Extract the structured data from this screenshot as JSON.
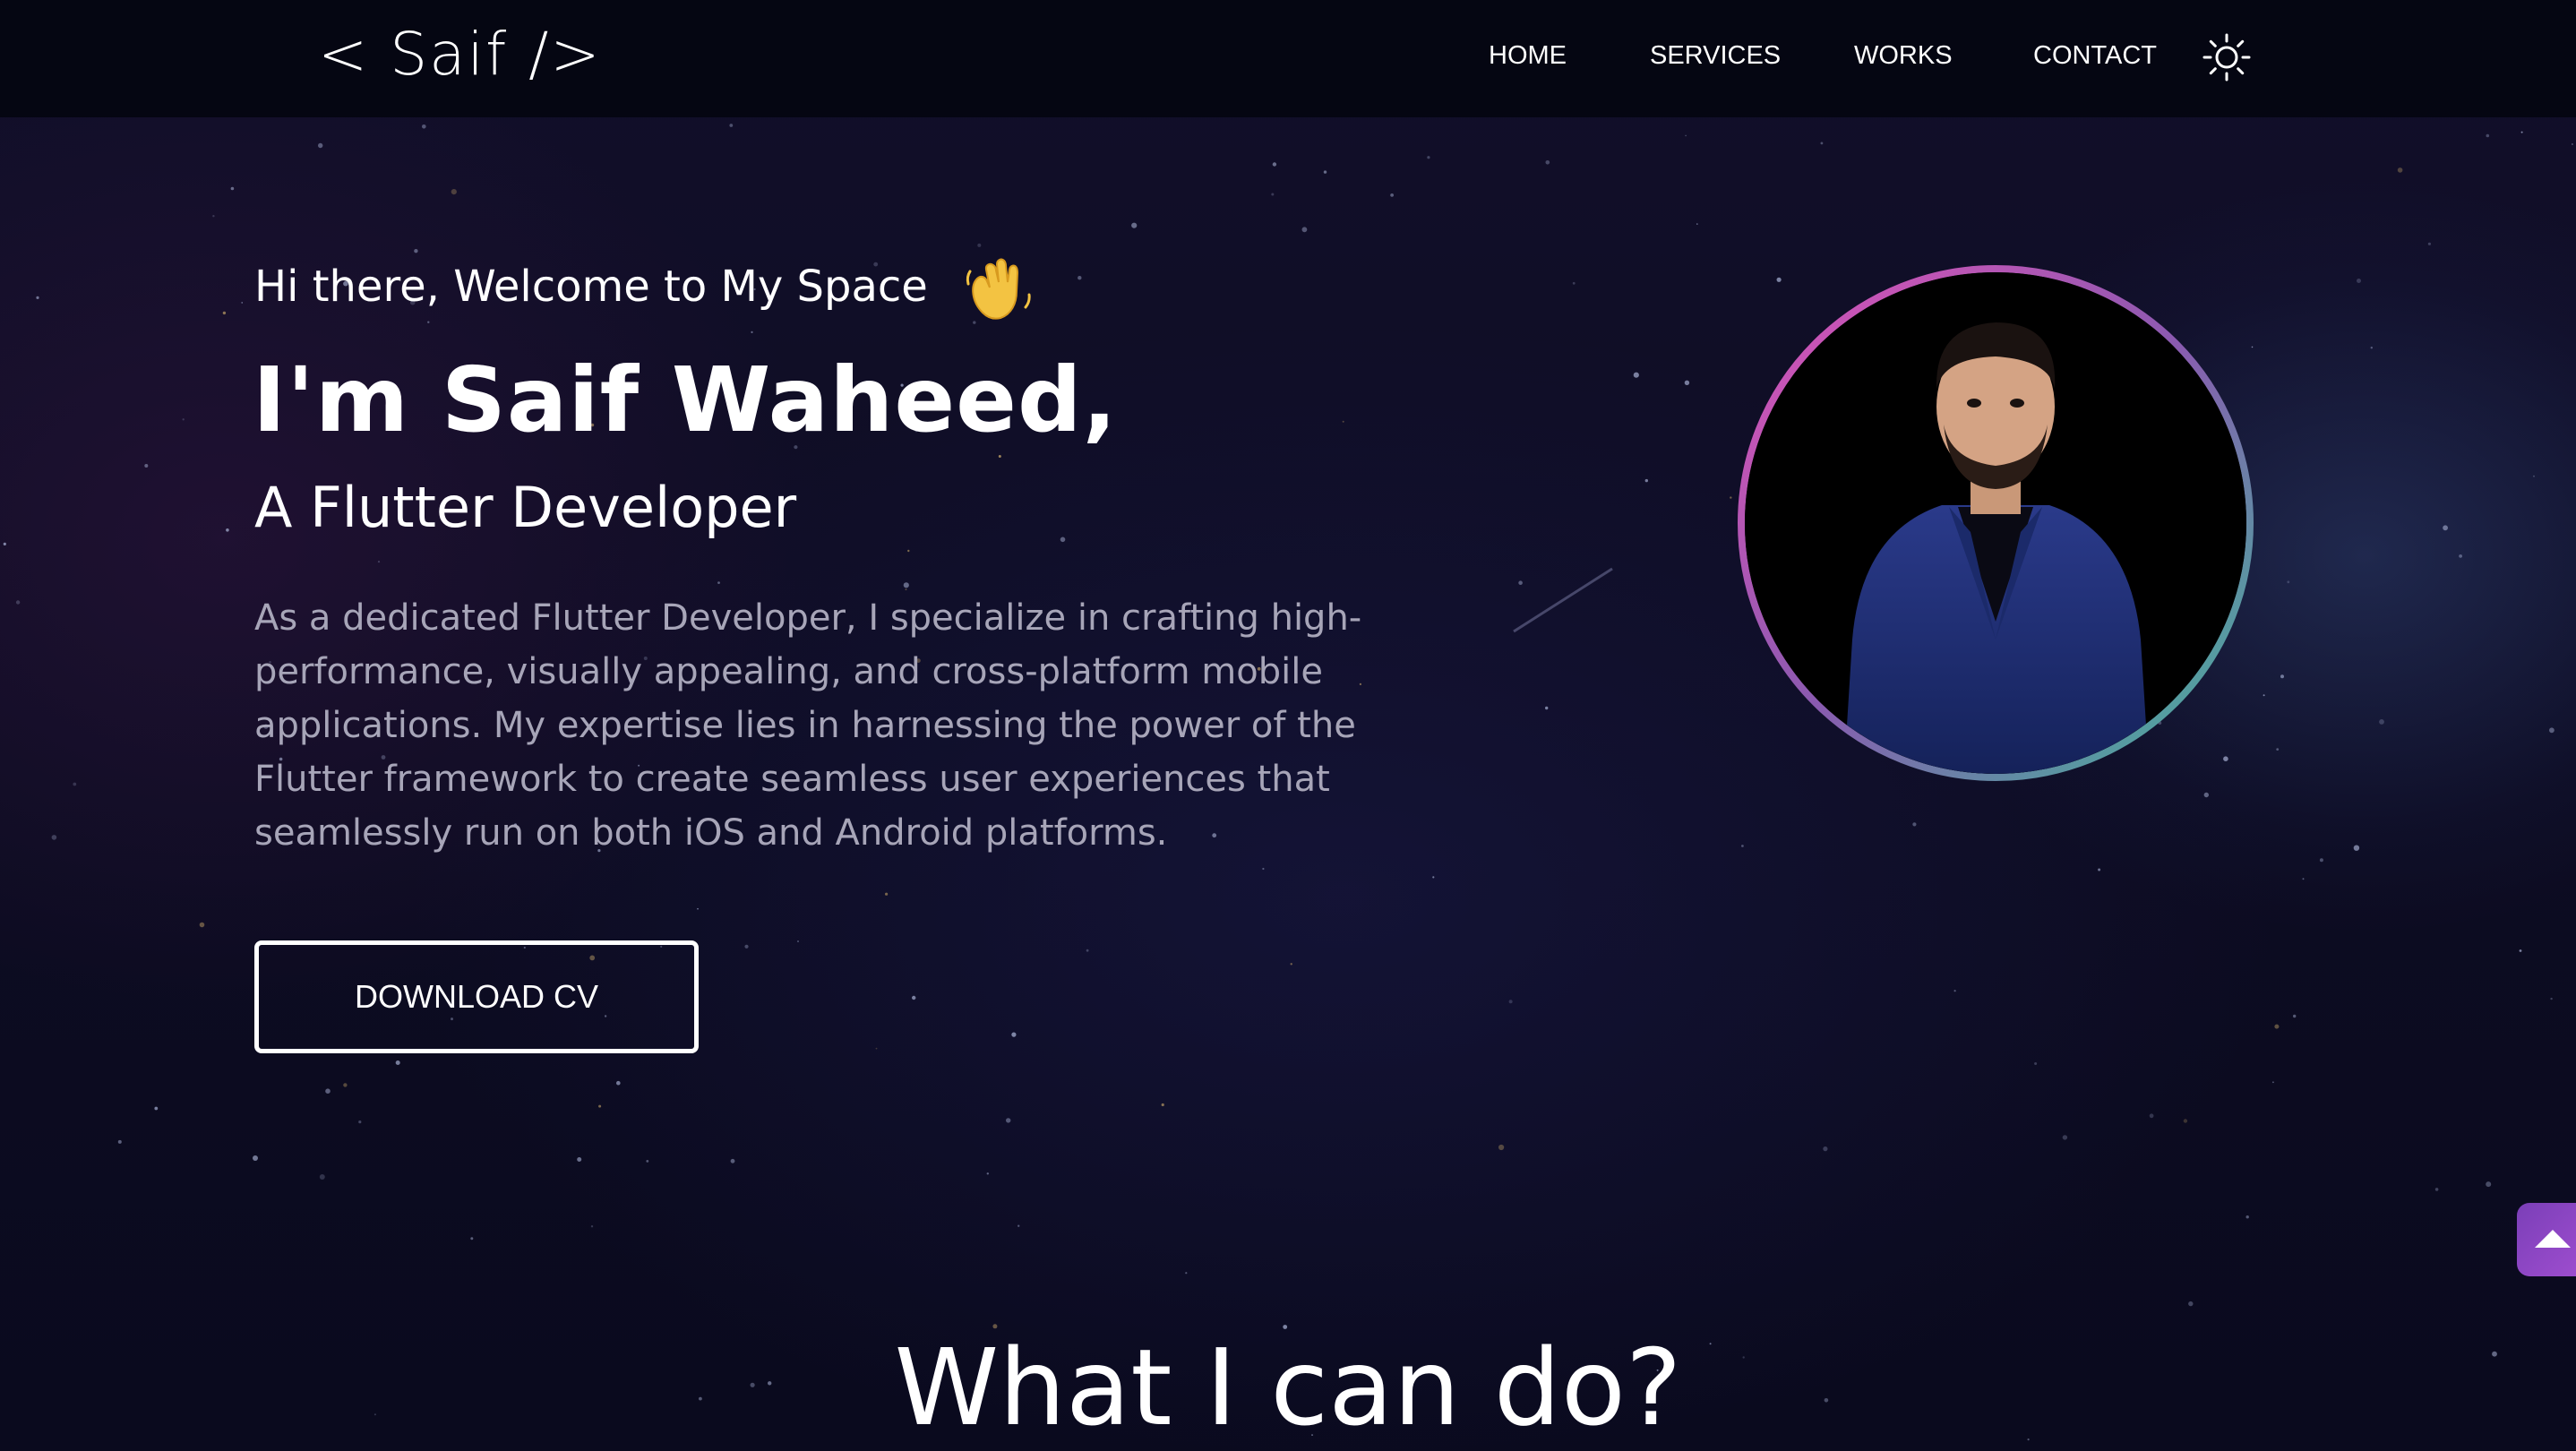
{
  "navbar": {
    "logo": "< Saif />",
    "links": [
      {
        "label": "HOME"
      },
      {
        "label": "SERVICES"
      },
      {
        "label": "WORKS"
      },
      {
        "label": "CONTACT"
      }
    ],
    "theme_toggle_icon": "sun-icon"
  },
  "hero": {
    "greeting": "Hi there, Welcome to My Space",
    "greeting_icon": "waving-hand-icon",
    "headline": "I'm Saif Waheed,",
    "role": "A  Flutter Developer",
    "bio": "As a dedicated Flutter Developer, I specialize in crafting high-performance, visually appealing, and cross-platform mobile applications. My expertise lies in harnessing the power of the Flutter framework to create seamless user experiences that seamlessly run on both iOS and Android platforms.",
    "cta_label": "DOWNLOAD CV",
    "profile_photo": "profile-photo",
    "ring_colors": [
      "#e052b8",
      "#3fb89a"
    ]
  },
  "services": {
    "title": "What I can do?"
  },
  "scroll_top_icon": "arrow-up-icon",
  "colors": {
    "background": "#0d0c22",
    "navbar": "#050612",
    "bio_text": "#a7a5b8",
    "scroll_button": "#8a45c2"
  }
}
